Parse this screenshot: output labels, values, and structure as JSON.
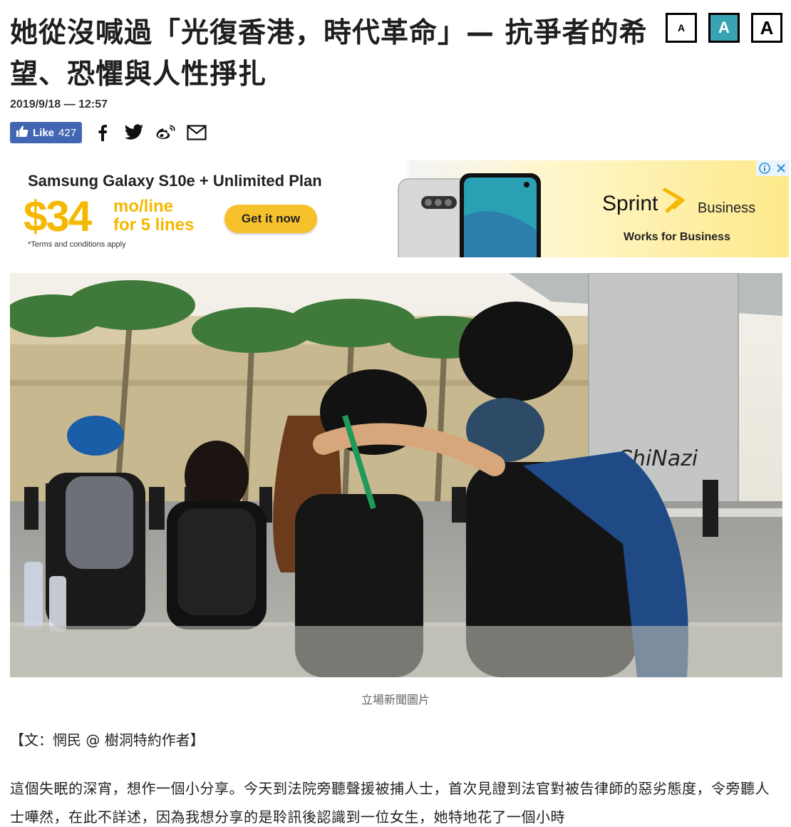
{
  "article": {
    "title": "她從沒喊過「光復香港，時代革命」— 抗爭者的希望、恐懼與人性掙扎",
    "date": "2019/9/18 — 12:57",
    "font_size_buttons": [
      "A",
      "A",
      "A"
    ]
  },
  "share": {
    "like_label": "Like",
    "like_count": "427",
    "icons": [
      "facebook-icon",
      "twitter-icon",
      "weibo-icon",
      "email-icon"
    ]
  },
  "ad": {
    "headline": "Samsung Galaxy S10e + Unlimited Plan",
    "price": "$34",
    "price_sub_1": "mo/line",
    "price_sub_2": "for 5 lines",
    "cta": "Get it now",
    "terms": "*Terms and conditions apply",
    "brand": "Sprint",
    "brand_suffix": "Business",
    "tagline": "Works for Business"
  },
  "photo": {
    "graffiti": "ChiNazi"
  },
  "caption": "立場新聞圖片",
  "byline": "【文：惘民 @ 樹洞特約作者】",
  "paragraph": "這個失眠的深宵，想作一個小分享。今天到法院旁聽聲援被捕人士，首次見證到法官對被告律師的惡劣態度，令旁聽人士嘩然，在此不詳述，因為我想分享的是聆訊後認識到一位女生，她特地花了一個小時",
  "colors": {
    "accent": "#3aa3b3",
    "facebook": "#4267b2",
    "ad_yellow": "#f5b800"
  }
}
